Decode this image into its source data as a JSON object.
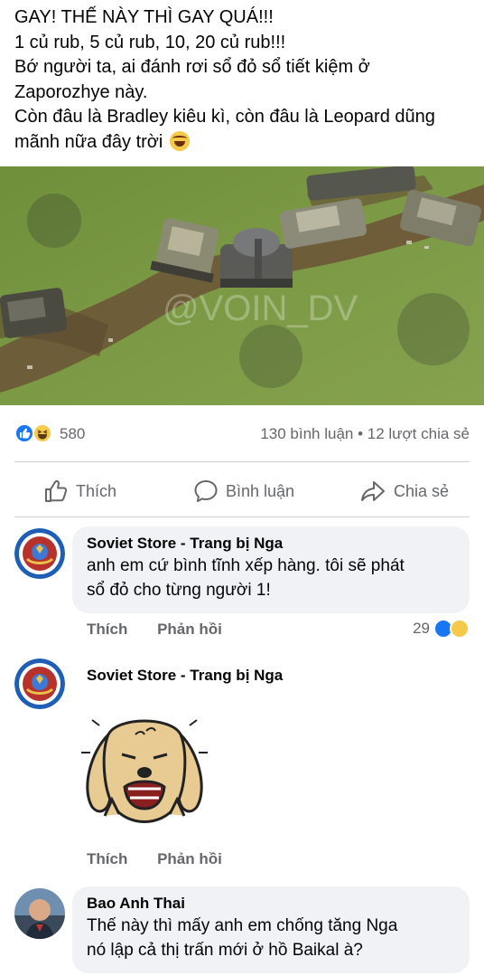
{
  "post": {
    "lines": [
      "GAY! THẾ NÀY THÌ GAY QUÁ!!!",
      "1 củ rub, 5 củ rub, 10, 20 củ rub!!!",
      "Bớ người ta, ai đánh rơi sổ đỏ sổ tiết kiệm ở",
      "Zaporozhye này.",
      "Còn đâu là Bradley kiêu kì, còn đâu là Leopard dũng",
      "mãnh nữa đây trời"
    ],
    "trailing_emoji": "rolling-laughing-emoji",
    "image_watermark": "@VOIN_DV"
  },
  "stats": {
    "reaction_icons": [
      "like-reaction-icon",
      "haha-reaction-icon"
    ],
    "reaction_count": "580",
    "comments_shares": "130 bình luận • 12 lượt chia sẻ"
  },
  "actions": {
    "like": "Thích",
    "comment": "Bình luận",
    "share": "Chia sẻ"
  },
  "comments": [
    {
      "author": "Soviet Store - Trang bị Nga",
      "text_lines": [
        "anh em cứ bình tĩnh xếp hàng. tôi sẽ phát",
        "sổ đỏ cho từng người 1!"
      ],
      "like_label": "Thích",
      "reply_label": "Phản hồi",
      "reaction_count": "29"
    },
    {
      "author": "Soviet Store - Trang bị Nga",
      "sticker": "crying-dog-sticker",
      "like_label": "Thích",
      "reply_label": "Phản hồi"
    },
    {
      "author": "Bao Anh Thai",
      "text_lines": [
        "Thế này thì mấy anh em chống tăng Nga",
        "nó lập cả thị trấn mới ở hồ Baikal à?"
      ]
    }
  ],
  "colors": {
    "text": "#050505",
    "secondary": "#65676b",
    "bubble": "#f0f2f5",
    "like_blue": "#1877f2",
    "haha_yellow": "#f7c948"
  }
}
